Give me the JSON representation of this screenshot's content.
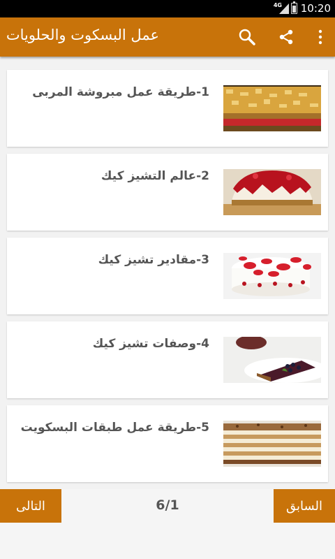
{
  "status_bar": {
    "time": "10:20",
    "network": "4G"
  },
  "app_bar": {
    "title": "عمل البسكوت والحلويات",
    "icons": [
      "search-icon",
      "share-icon",
      "overflow-menu-icon"
    ]
  },
  "items": [
    {
      "label": "1-طريقة عمل مبروشة المربى",
      "image": "baklava-tray"
    },
    {
      "label": "2-عالم التشيز كيك",
      "image": "cherry-cheesecake"
    },
    {
      "label": "3-مقادير تشيز كيك",
      "image": "strawberry-cheesecake"
    },
    {
      "label": "4-وصفات تشيز كيك",
      "image": "chocolate-cake-slice"
    },
    {
      "label": "5-طريقة عمل طبقات البسكويت",
      "image": "layered-biscuit-cake"
    }
  ],
  "footer": {
    "next_label": "التالى",
    "prev_label": "السابق",
    "page": "6/1"
  },
  "colors": {
    "accent": "#c8730a",
    "status_bar": "#000000",
    "background": "#f2f2f2"
  }
}
